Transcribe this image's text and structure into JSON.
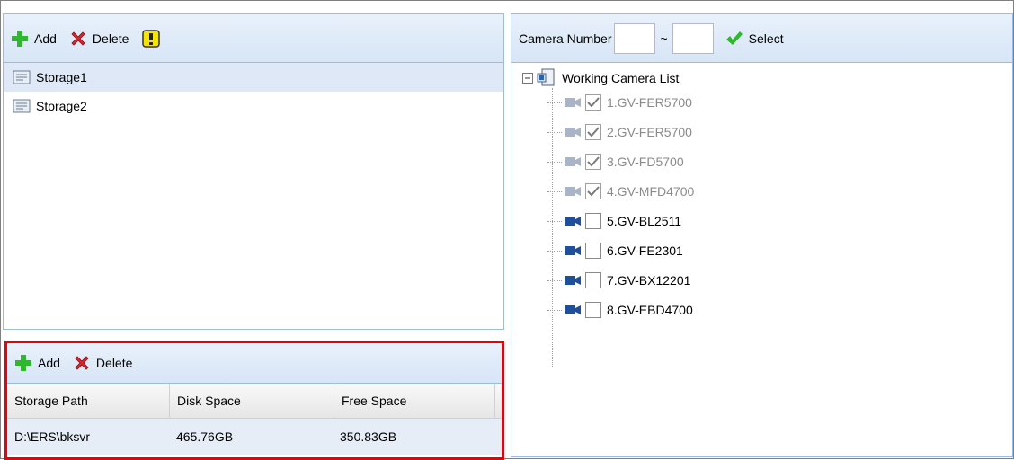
{
  "storage_toolbar": {
    "add_label": "Add",
    "delete_label": "Delete"
  },
  "storages": [
    {
      "label": "Storage1",
      "selected": true
    },
    {
      "label": "Storage2",
      "selected": false
    }
  ],
  "path_toolbar": {
    "add_label": "Add",
    "delete_label": "Delete"
  },
  "path_grid": {
    "columns": [
      "Storage Path",
      "Disk Space",
      "Free Space"
    ],
    "rows": [
      {
        "path": "D:\\ERS\\bksvr",
        "disk": "465.76GB",
        "free": "350.83GB"
      }
    ]
  },
  "camera_filter": {
    "label": "Camera Number",
    "from_value": "",
    "to_value": "",
    "separator": "~",
    "select_label": "Select"
  },
  "camera_tree": {
    "root_label": "Working Camera List",
    "cameras": [
      {
        "label": "1.GV-FER5700",
        "checked": true,
        "disabled": true
      },
      {
        "label": "2.GV-FER5700",
        "checked": true,
        "disabled": true
      },
      {
        "label": "3.GV-FD5700",
        "checked": true,
        "disabled": true
      },
      {
        "label": "4.GV-MFD4700",
        "checked": true,
        "disabled": true
      },
      {
        "label": "5.GV-BL2511",
        "checked": false,
        "disabled": false
      },
      {
        "label": "6.GV-FE2301",
        "checked": false,
        "disabled": false
      },
      {
        "label": "7.GV-BX12201",
        "checked": false,
        "disabled": false
      },
      {
        "label": "8.GV-EBD4700",
        "checked": false,
        "disabled": false
      }
    ]
  },
  "colors": {
    "accent_blue": "#99bbe8",
    "highlight_red": "#e8000b",
    "add_green": "#2eb82e",
    "delete_red": "#d9262f",
    "warn_yellow": "#f5e400"
  }
}
